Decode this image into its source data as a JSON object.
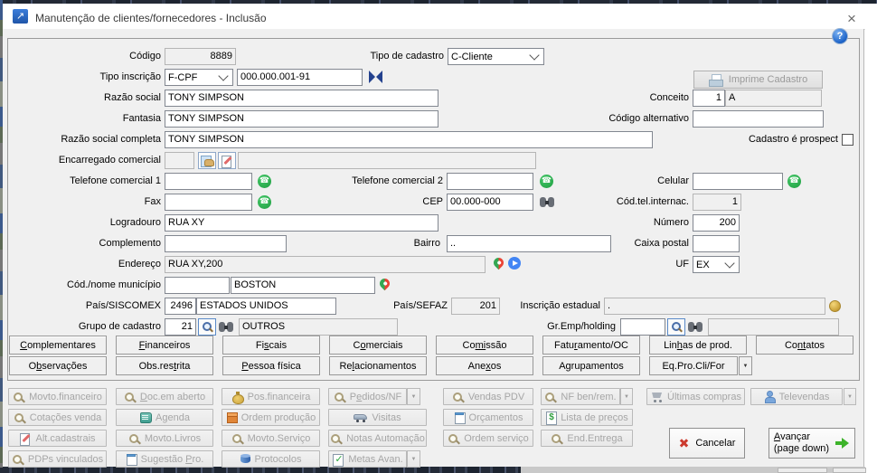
{
  "window": {
    "title": "Manutenção de clientes/fornecedores - Inclusão"
  },
  "icons": {
    "close": "×",
    "help": "?",
    "split_arrow": "▼"
  },
  "colors": {
    "window_bg": "#f0f0f0",
    "phone_green": "#2fb34f",
    "help_blue": "#1c63c8",
    "disabled_text": "#a6a6a6",
    "cancel_red": "#cc3a2e",
    "advance_green": "#3db32a"
  },
  "form": {
    "codigo": {
      "label": "Código",
      "value": "8889"
    },
    "tipo_cadastro": {
      "label": "Tipo de cadastro",
      "value": "C-Cliente"
    },
    "tipo_inscricao": {
      "label": "Tipo inscrição",
      "value": "F-CPF",
      "numero": "000.000.001-91"
    },
    "razao_social": {
      "label": "Razão social",
      "value": "TONY SIMPSON"
    },
    "conceito": {
      "label": "Conceito",
      "value": "1",
      "grade": "A"
    },
    "fantasia": {
      "label": "Fantasia",
      "value": "TONY SIMPSON"
    },
    "codigo_alternativo": {
      "label": "Código alternativo",
      "value": ""
    },
    "razao_social_completa": {
      "label": "Razão social completa",
      "value": "TONY SIMPSON"
    },
    "cadastro_prospect": {
      "label": "Cadastro é prospect",
      "checked": false
    },
    "encarregado_comercial": {
      "label": "Encarregado comercial",
      "codigo": "",
      "nome": ""
    },
    "telefone1": {
      "label": "Telefone comercial 1",
      "value": ""
    },
    "telefone2": {
      "label": "Telefone comercial 2",
      "value": ""
    },
    "celular": {
      "label": "Celular",
      "value": ""
    },
    "fax": {
      "label": "Fax",
      "value": ""
    },
    "cep": {
      "label": "CEP",
      "value": "00.000-000"
    },
    "cod_tel_internac": {
      "label": "Cód.tel.internac.",
      "value": "1"
    },
    "logradouro": {
      "label": "Logradouro",
      "value": "RUA XY"
    },
    "numero": {
      "label": "Número",
      "value": "200"
    },
    "complemento": {
      "label": "Complemento",
      "value": ""
    },
    "bairro": {
      "label": "Bairro",
      "value": ".."
    },
    "caixa_postal": {
      "label": "Caixa postal",
      "value": ""
    },
    "endereco": {
      "label": "Endereço",
      "value": "RUA XY,200"
    },
    "uf": {
      "label": "UF",
      "value": "EX"
    },
    "municipio": {
      "label": "Cód./nome município",
      "codigo": "",
      "nome": "BOSTON"
    },
    "pais_siscomex": {
      "label": "País/SISCOMEX",
      "codigo": "2496",
      "nome": "ESTADOS UNIDOS"
    },
    "pais_sefaz": {
      "label": "País/SEFAZ",
      "value": "201"
    },
    "inscricao_estadual": {
      "label": "Inscrição estadual",
      "value": "."
    },
    "grupo_cadastro": {
      "label": "Grupo de cadastro",
      "codigo": "21",
      "nome": "OUTROS"
    },
    "gr_emp_holding": {
      "label": "Gr.Emp/holding",
      "codigo": "",
      "nome": ""
    }
  },
  "actions": {
    "imprime": {
      "label": "Imprime Cadastro",
      "icon": "printer-icon"
    },
    "cancel": {
      "label": "Cancelar",
      "icon": "red-x-icon"
    },
    "advance": {
      "label": "Avançar",
      "sub": "(page down)",
      "accel": "A",
      "icon": "green-arrow-icon"
    }
  },
  "tabs": {
    "row1": [
      {
        "label": "Complementares",
        "accel": "C"
      },
      {
        "label": "Financeiros",
        "accel": "F"
      },
      {
        "label": "Fiscais",
        "accel": "s"
      },
      {
        "label": "Comerciais",
        "accel": "o"
      },
      {
        "label": "Comissão",
        "accel": "mi"
      },
      {
        "label": "Faturamento/OC",
        "accel": "r"
      },
      {
        "label": "Linhas de prod.",
        "accel": "h"
      },
      {
        "label": "Contatos",
        "accel": "nt"
      }
    ],
    "row2": [
      {
        "label": "Observações",
        "accel": "b"
      },
      {
        "label": "Obs.restrita",
        "accel": "t"
      },
      {
        "label": "Pessoa física",
        "accel": "P"
      },
      {
        "label": "Relacionamentos",
        "accel": "l"
      },
      {
        "label": "Anexos",
        "accel": "x"
      },
      {
        "label": "Agrupamentos"
      },
      {
        "label": "Eq.Pro.Cli/For",
        "split": true
      }
    ]
  },
  "quick": {
    "row1": [
      {
        "label": "Movto.financeiro",
        "icon": "magnifier-icon"
      },
      {
        "label": "Doc.em aberto",
        "accel": "D",
        "icon": "magnifier-icon"
      },
      {
        "label": "Pos.financeira",
        "icon": "money-bag-icon"
      },
      {
        "label": "Pedidos/NF",
        "accel": "e",
        "icon": "magnifier-icon",
        "split": true
      },
      {
        "label": "Vendas PDV",
        "icon": "magnifier-icon"
      },
      {
        "label": "NF ben/rem.",
        "icon": "magnifier-icon",
        "split": true
      },
      {
        "label": "Últimas compras",
        "icon": "shopping-cart-icon"
      },
      {
        "label": "Televendas",
        "icon": "person-icon",
        "split": true
      }
    ],
    "row2": [
      {
        "label": "Cotações venda",
        "icon": "magnifier-icon"
      },
      {
        "label": "Agenda",
        "accel": "g",
        "icon": "book-icon"
      },
      {
        "label": "Ordem produção",
        "icon": "box-icon"
      },
      {
        "label": "Visitas",
        "icon": "car-icon"
      },
      {
        "label": "Orçamentos",
        "icon": "notepad-icon"
      },
      {
        "label": "Lista de preços",
        "icon": "price-list-icon"
      }
    ],
    "row3": [
      {
        "label": "Alt.cadastrais",
        "icon": "edit-page-icon"
      },
      {
        "label": "Movto.Livros",
        "icon": "magnifier-icon"
      },
      {
        "label": "Movto.Serviço",
        "icon": "magnifier-icon"
      },
      {
        "label": "Notas Automação",
        "icon": "magnifier-icon"
      },
      {
        "label": "Ordem serviço",
        "icon": "magnifier-icon"
      },
      {
        "label": "End.Entrega",
        "icon": "magnifier-icon"
      }
    ],
    "row4": [
      {
        "label": "PDPs vinculados",
        "icon": "magnifier-icon"
      },
      {
        "label": "Sugestão Pro.",
        "accel": "P",
        "icon": "notepad-icon"
      },
      {
        "label": "Protocolos",
        "icon": "database-icon"
      },
      {
        "label": "Metas Avan.",
        "icon": "check-doc-icon",
        "split": true
      }
    ]
  }
}
